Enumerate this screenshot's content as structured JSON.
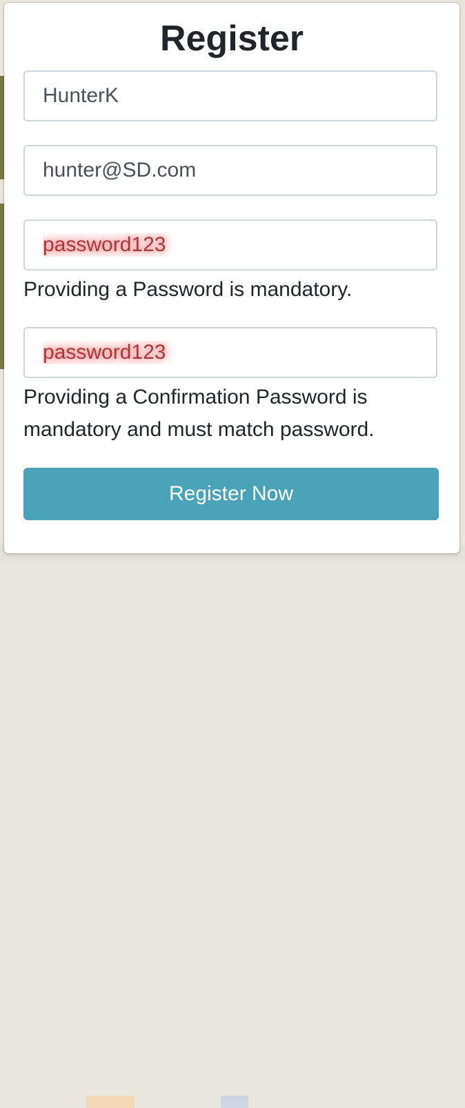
{
  "modal": {
    "title": "Register",
    "username": {
      "value": "HunterK"
    },
    "email": {
      "value": "hunter@SD.com"
    },
    "password": {
      "value": "password123",
      "error": "Providing a Password is mandatory."
    },
    "confirm_password": {
      "value": "password123",
      "error": "Providing a Confirmation Password is mandatory and must match password."
    },
    "submit_label": "Register Now"
  },
  "colors": {
    "button": "#48a2b8",
    "highlight": "#f05050",
    "input_border": "#ced4da"
  }
}
